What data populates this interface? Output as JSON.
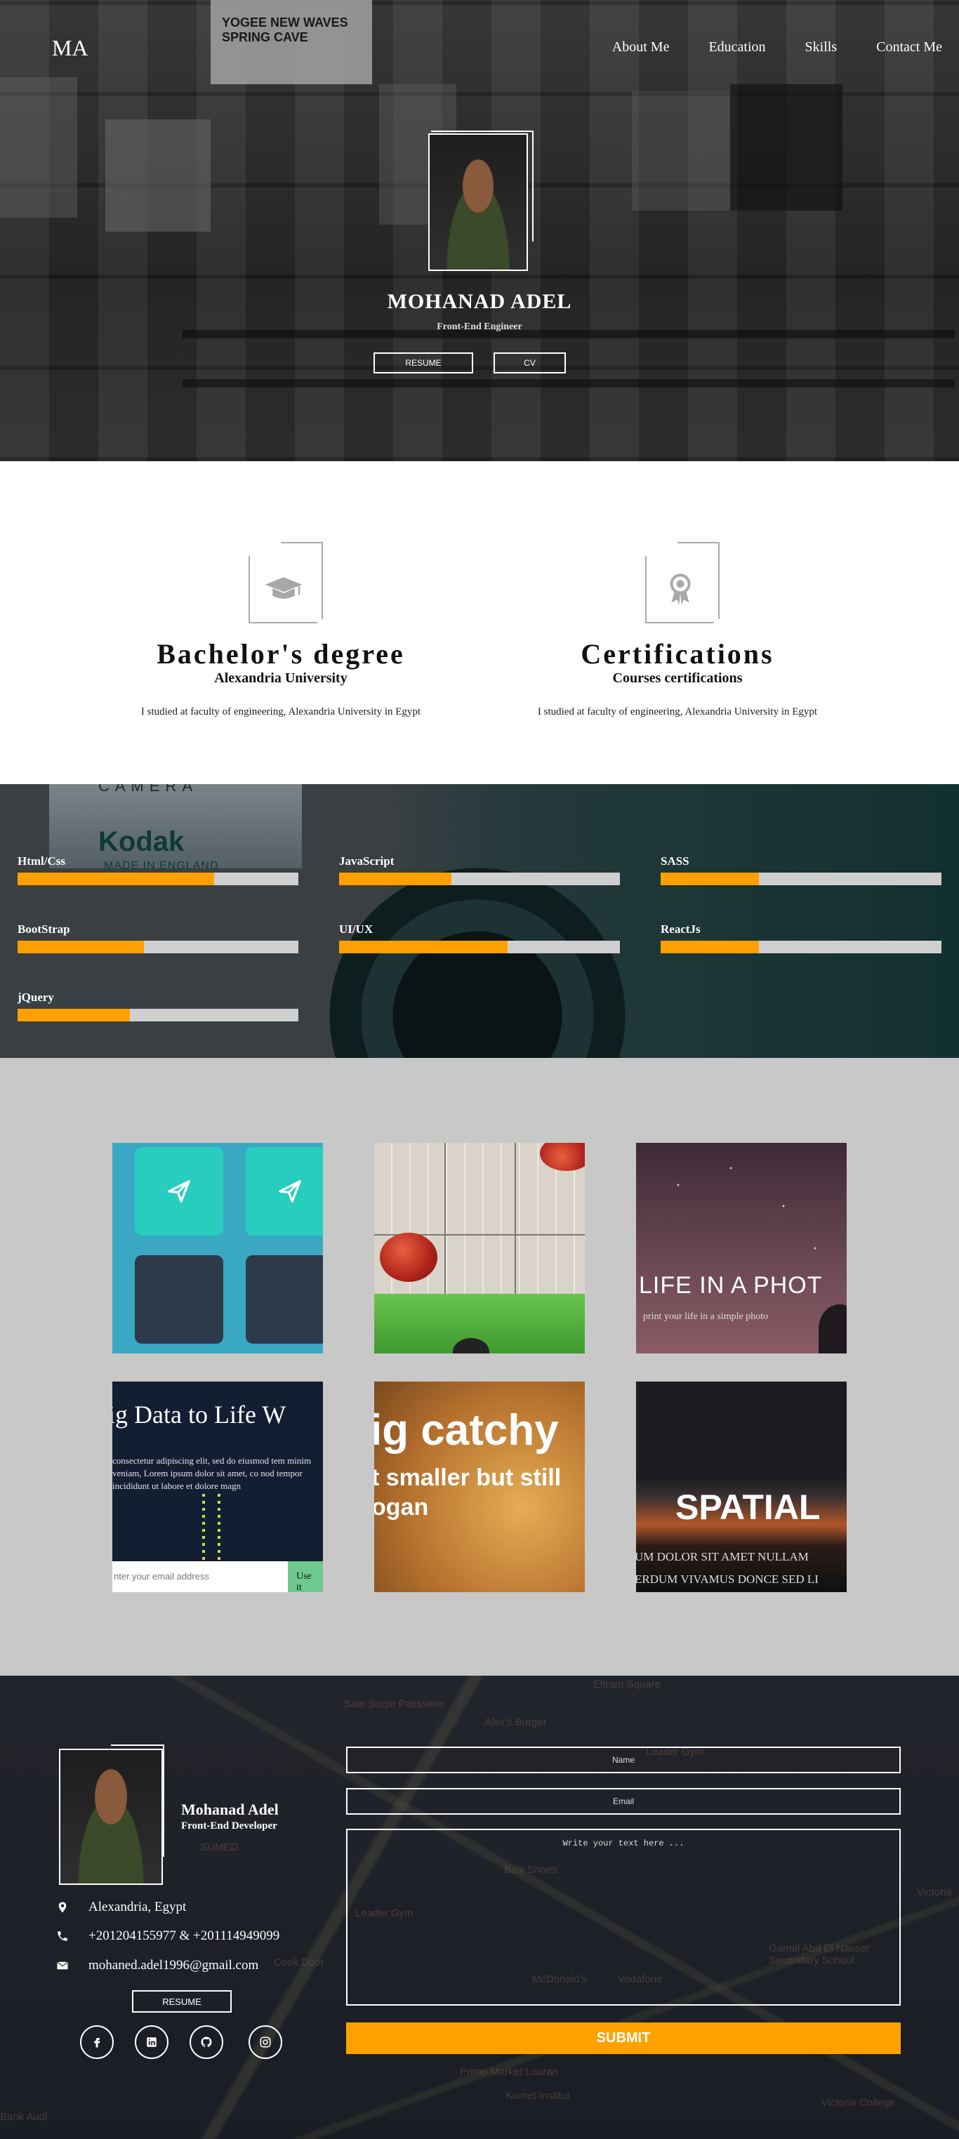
{
  "header": {
    "logo": "MA",
    "nav": [
      "About Me",
      "Education",
      "Skills",
      "Contact Me"
    ]
  },
  "hero": {
    "name": "MOHANAD ADEL",
    "role": "Front-End Engineer",
    "resume_label": "RESUME",
    "cv_label": "CV",
    "poster_text": "YOGEE NEW WAVES SPRING CAVE"
  },
  "education": [
    {
      "icon": "graduation-cap-icon",
      "title": "Bachelor's degree",
      "subtitle": "Alexandria University",
      "text": "I studied at faculty of engineering, Alexandria University in Egypt"
    },
    {
      "icon": "certificate-icon",
      "title": "Certifications",
      "subtitle": "Courses certifications",
      "text": "I studied at faculty of engineering, Alexandria University in Egypt"
    }
  ],
  "skills_bg": {
    "camera": "CAMERA",
    "brand": "Kodak",
    "made": "MADE IN ENGLAND"
  },
  "skills": [
    {
      "label": "Html/Css",
      "level": 0.7
    },
    {
      "label": "JavaScript",
      "level": 0.4
    },
    {
      "label": "SASS",
      "level": 0.35
    },
    {
      "label": "BootStrap",
      "level": 0.45
    },
    {
      "label": "UI/UX",
      "level": 0.6
    },
    {
      "label": "ReactJs",
      "level": 0.35
    },
    {
      "label": "jQuery",
      "level": 0.4
    }
  ],
  "portfolio": {
    "tile3_title": "LIFE IN A PHOT",
    "tile3_sub": "print your life in a simple photo",
    "tile4_title": "ig Data to Life W",
    "tile4_body": "consectetur adipiscing elit, sed do eiusmod tem minim veniam, Lorem ipsum dolor sit amet, co nod tempor incididunt ut labore et dolore magn",
    "tile4_input": "nter your email address",
    "tile4_button": "Use it",
    "tile5_line1": "ig catchy",
    "tile5_line2": "t smaller but still",
    "tile5_line3": "ogan",
    "tile6_title": "SPATIAL",
    "tile6_line1": "UM DOLOR SIT AMET NULLAM",
    "tile6_line2": "ERDUM VIVAMUS DONCE SED LI"
  },
  "footer": {
    "name": "Mohanad Adel",
    "role": "Front-End Developer",
    "location": "Alexandria, Egypt",
    "phone": "+201204155977 & +201114949099",
    "email": "mohaned.adel1996@gmail.com",
    "resume_label": "RESUME",
    "social": [
      "facebook-icon",
      "linkedin-icon",
      "github-icon",
      "instagram-icon"
    ],
    "form": {
      "name_placeholder": "Name",
      "email_placeholder": "Email",
      "message_placeholder": "Write your text here ...",
      "submit_label": "SUBMIT"
    },
    "map_labels": [
      "Eltram Square",
      "Sale Sucre Patisserie",
      "Alex's Burger",
      "Leader Gym",
      "Baly Shoes",
      "McDonald's",
      "Vodafone",
      "Gamal Abd El Nasser Secondary School",
      "Komet Institut",
      "Victoria College",
      "Victoria",
      "Bank Audi",
      "Primo Market Louran",
      "Leader Gym",
      "SUMED",
      "Cook Door"
    ]
  },
  "colors": {
    "accent": "#ffa200",
    "skill_fill": "#ff9f00",
    "portfolio_bg": "#c8c8c8"
  }
}
